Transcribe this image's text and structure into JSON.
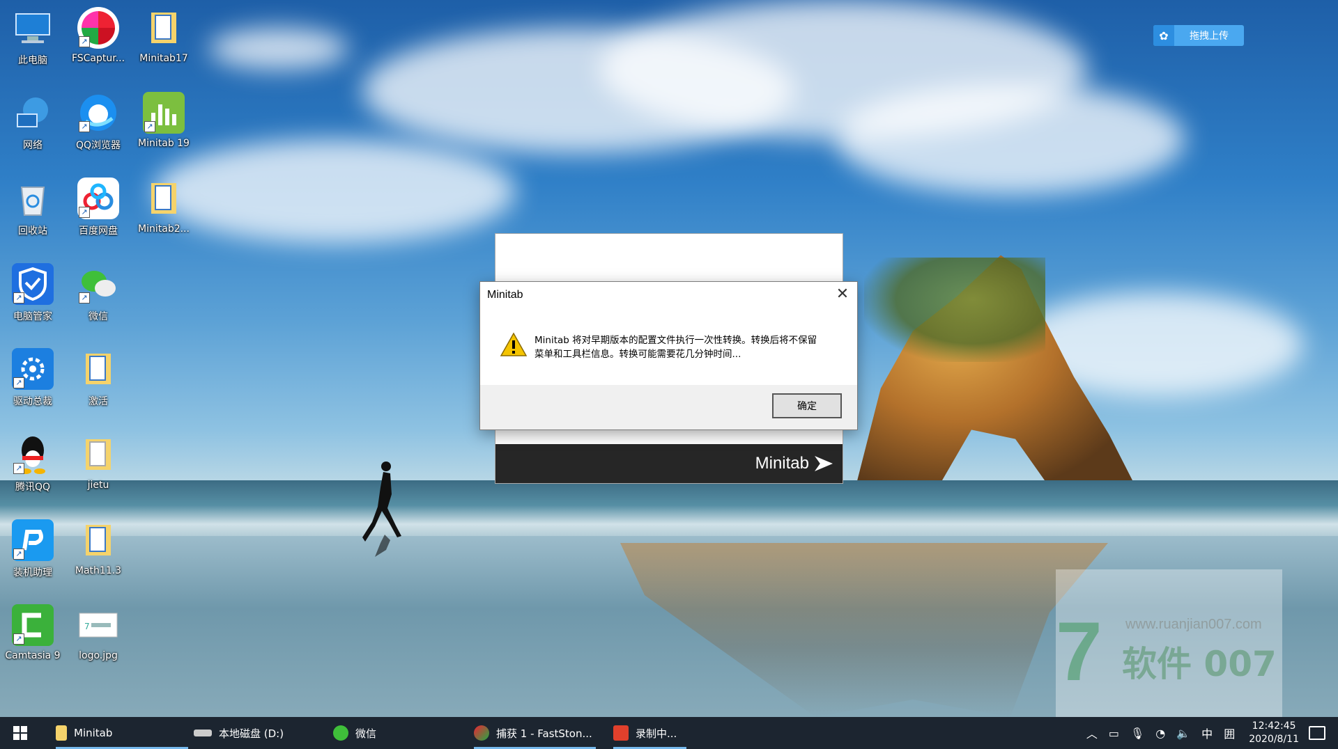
{
  "desktop": {
    "icons": [
      {
        "label": "此电脑",
        "icon": "computer-icon"
      },
      {
        "label": "FSCaptur...",
        "icon": "fscapture-icon"
      },
      {
        "label": "Minitab17",
        "icon": "folder-icon"
      },
      {
        "label": "网络",
        "icon": "network-icon"
      },
      {
        "label": "QQ浏览器",
        "icon": "qq-browser-icon"
      },
      {
        "label": "Minitab 19",
        "icon": "minitab-icon"
      },
      {
        "label": "回收站",
        "icon": "recycle-bin-icon"
      },
      {
        "label": "百度网盘",
        "icon": "baidu-netdisk-icon"
      },
      {
        "label": "Minitab2...",
        "icon": "folder-icon"
      },
      {
        "label": "电脑管家",
        "icon": "pc-manager-icon"
      },
      {
        "label": "微信",
        "icon": "wechat-icon"
      },
      {
        "label": "驱动总裁",
        "icon": "driver-icon"
      },
      {
        "label": "激活",
        "icon": "folder-icon"
      },
      {
        "label": "腾讯QQ",
        "icon": "qq-icon"
      },
      {
        "label": "jietu",
        "icon": "folder-icon"
      },
      {
        "label": "装机助理",
        "icon": "install-assistant-icon"
      },
      {
        "label": "Math11.3",
        "icon": "folder-icon"
      },
      {
        "label": "Camtasia 9",
        "icon": "camtasia-icon"
      },
      {
        "label": "logo.jpg",
        "icon": "image-file-icon"
      }
    ]
  },
  "upload_button": {
    "label": "拖拽上传"
  },
  "splash": {
    "brand": "Minitab"
  },
  "dialog": {
    "title": "Minitab",
    "message_line1": "Minitab 将对早期版本的配置文件执行一次性转换。转换后将不保留",
    "message_line2": "菜单和工具栏信息。转换可能需要花几分钟时间...",
    "ok_label": "确定"
  },
  "watermark": {
    "url": "www.ruanjian007.com",
    "brand": "软件 007",
    "digit": "7"
  },
  "taskbar": {
    "items": [
      {
        "label": "Minitab",
        "icon": "folder-icon"
      },
      {
        "label": "本地磁盘 (D:)",
        "icon": "drive-icon"
      },
      {
        "label": "微信",
        "icon": "wechat-icon"
      },
      {
        "label": "捕获 1 - FastSton...",
        "icon": "fscapture-icon"
      },
      {
        "label": "录制中...",
        "icon": "camtasia-recorder-icon"
      }
    ],
    "tray": {
      "ime": "中",
      "ime_mode": "囲",
      "time": "12:42:45",
      "date": "2020/8/11"
    }
  },
  "colors": {
    "taskbar": "#1c2530",
    "dialog_footer": "#f0f0f0",
    "upload": "#4aa8f0"
  }
}
